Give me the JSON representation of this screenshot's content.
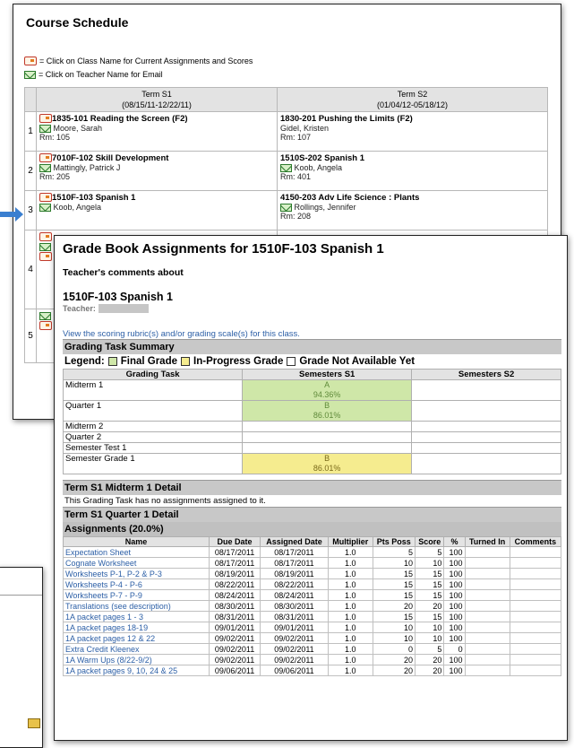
{
  "course_schedule": {
    "title": "Course Schedule",
    "legend": {
      "class_hint": "= Click on Class Name for Current Assignments and Scores",
      "teacher_hint": "= Click on Teacher Name for Email"
    },
    "terms": [
      {
        "label": "Term S1",
        "dates": "(08/15/11-12/22/11)"
      },
      {
        "label": "Term S2",
        "dates": "(01/04/12-05/18/12)"
      }
    ],
    "rows": [
      {
        "period": "1",
        "s1": {
          "class": "1835-101 Reading the Screen (F2)",
          "teacher": "Moore, Sarah",
          "room": "Rm: 105"
        },
        "s2": {
          "class": "1830-201 Pushing the Limits (F2)",
          "teacher": "Gidel, Kristen",
          "room": "Rm: 107"
        }
      },
      {
        "period": "2",
        "s1": {
          "class": "7010F-102 Skill Development",
          "teacher": "Mattingly, Patrick J",
          "room": "Rm: 205"
        },
        "s2": {
          "class": "1510S-202 Spanish 1",
          "teacher": "Koob, Angela",
          "room": "Rm: 401"
        }
      },
      {
        "period": "3",
        "s1": {
          "class": "1510F-103 Spanish 1",
          "teacher": "Koob, Angela",
          "room": ""
        },
        "s2": {
          "class": "4150-203 Adv Life Science : Plants",
          "teacher": "Rollings, Jennifer",
          "room": "Rm: 208"
        }
      },
      {
        "period": "4"
      },
      {
        "period": "5"
      }
    ]
  },
  "gradebook": {
    "title": "Grade Book Assignments for 1510F-103 Spanish 1",
    "comments_label": "Teacher's comments about",
    "course": "1510F-103 Spanish 1",
    "teacher_label": "Teacher:",
    "rubric_link": "View the scoring rubric(s) and/or grading scale(s) for this class.",
    "summary_header": "Grading Task Summary",
    "legend": {
      "prefix": "Legend:",
      "final": "Final Grade",
      "in_progress": "In-Progress Grade",
      "not_available": "Grade Not Available Yet"
    },
    "task_columns": [
      "Grading Task",
      "Semesters S1",
      "Semesters S2"
    ],
    "tasks": [
      {
        "name": "Midterm 1",
        "grade": "A",
        "pct": "94.36%",
        "status": "final"
      },
      {
        "name": "Quarter 1",
        "grade": "B",
        "pct": "86.01%",
        "status": "final"
      },
      {
        "name": "Midterm 2",
        "grade": "",
        "pct": "",
        "status": "na"
      },
      {
        "name": "Quarter 2",
        "grade": "",
        "pct": "",
        "status": "na"
      },
      {
        "name": "Semester Test 1",
        "grade": "",
        "pct": "",
        "status": "na"
      },
      {
        "name": "Semester Grade 1",
        "grade": "B",
        "pct": "86.01%",
        "status": "progress"
      }
    ],
    "midterm_detail_header": "Term S1 Midterm 1 Detail",
    "midterm_detail_text": "This Grading Task has no assignments assigned to it.",
    "quarter_detail_header": "Term S1 Quarter 1 Detail",
    "assignments_header": "Assignments (20.0%)",
    "assignment_columns": [
      "Name",
      "Due Date",
      "Assigned Date",
      "Multiplier",
      "Pts Poss",
      "Score",
      "%",
      "Turned In",
      "Comments"
    ],
    "assignments": [
      {
        "name": "Expectation Sheet",
        "due": "08/17/2011",
        "assigned": "08/17/2011",
        "mult": "1.0",
        "poss": "5",
        "score": "5",
        "pct": "100"
      },
      {
        "name": "Cognate Worksheet",
        "due": "08/17/2011",
        "assigned": "08/17/2011",
        "mult": "1.0",
        "poss": "10",
        "score": "10",
        "pct": "100"
      },
      {
        "name": "Worksheets P-1, P-2 & P-3",
        "due": "08/19/2011",
        "assigned": "08/19/2011",
        "mult": "1.0",
        "poss": "15",
        "score": "15",
        "pct": "100"
      },
      {
        "name": "Worksheets P-4 - P-6",
        "due": "08/22/2011",
        "assigned": "08/22/2011",
        "mult": "1.0",
        "poss": "15",
        "score": "15",
        "pct": "100"
      },
      {
        "name": "Worksheets P-7 - P-9",
        "due": "08/24/2011",
        "assigned": "08/24/2011",
        "mult": "1.0",
        "poss": "15",
        "score": "15",
        "pct": "100"
      },
      {
        "name": "Translations (see description)",
        "due": "08/30/2011",
        "assigned": "08/30/2011",
        "mult": "1.0",
        "poss": "20",
        "score": "20",
        "pct": "100"
      },
      {
        "name": "1A packet pages 1 - 3",
        "due": "08/31/2011",
        "assigned": "08/31/2011",
        "mult": "1.0",
        "poss": "15",
        "score": "15",
        "pct": "100"
      },
      {
        "name": "1A packet pages 18-19",
        "due": "09/01/2011",
        "assigned": "09/01/2011",
        "mult": "1.0",
        "poss": "10",
        "score": "10",
        "pct": "100"
      },
      {
        "name": "1A packet pages 12 & 22",
        "due": "09/02/2011",
        "assigned": "09/02/2011",
        "mult": "1.0",
        "poss": "10",
        "score": "10",
        "pct": "100"
      },
      {
        "name": "Extra Credit Kleenex",
        "due": "09/02/2011",
        "assigned": "09/02/2011",
        "mult": "1.0",
        "poss": "0",
        "score": "5",
        "pct": "0"
      },
      {
        "name": "1A Warm Ups (8/22-9/2)",
        "due": "09/02/2011",
        "assigned": "09/02/2011",
        "mult": "1.0",
        "poss": "20",
        "score": "20",
        "pct": "100"
      },
      {
        "name": "1A packet pages 9, 10, 24 & 25",
        "due": "09/06/2011",
        "assigned": "09/06/2011",
        "mult": "1.0",
        "poss": "20",
        "score": "20",
        "pct": "100"
      }
    ]
  },
  "colors": {
    "final": "#cfe7a8",
    "progress": "#f5ec8f",
    "link": "#2c5fa6",
    "arrow": "#3a7fd0"
  }
}
